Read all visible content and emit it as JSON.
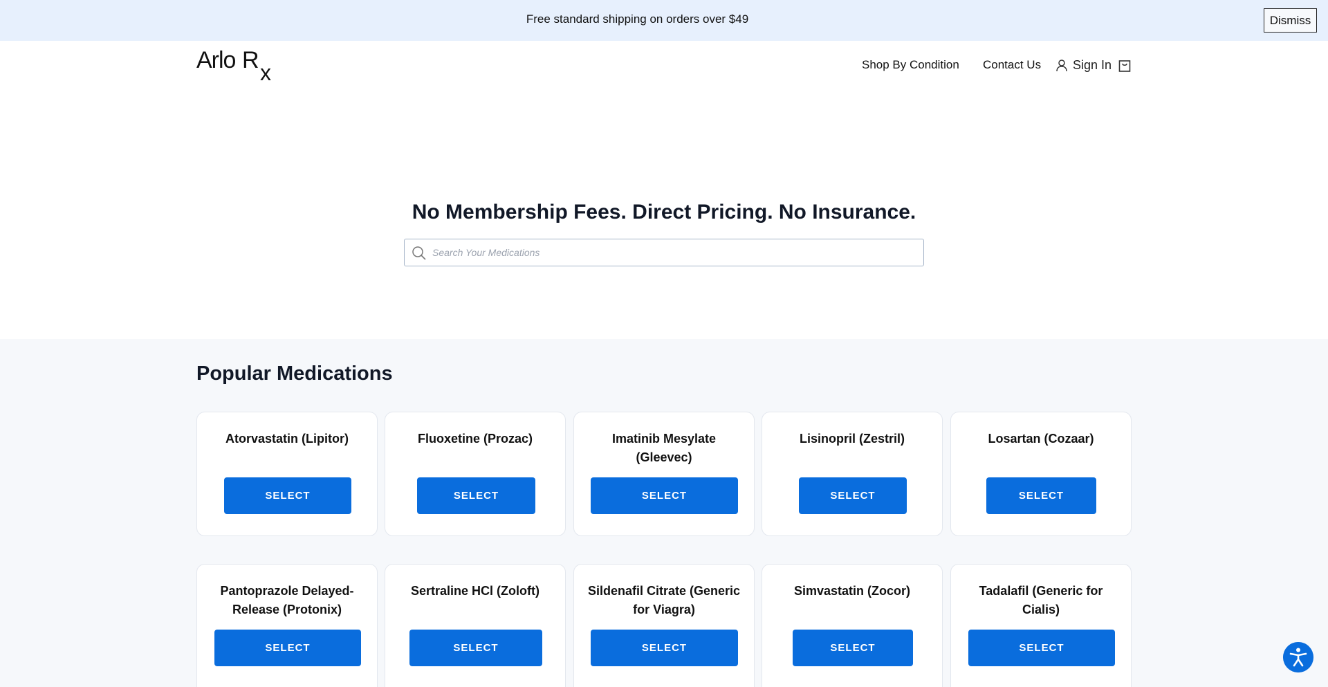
{
  "promo": {
    "text": "Free standard shipping on orders over $49",
    "dismiss_label": "Dismiss"
  },
  "header": {
    "logo": "ArloRx",
    "nav": {
      "shop_by_condition": "Shop By Condition",
      "contact_us": "Contact Us",
      "sign_in": "Sign In"
    },
    "icons": [
      "user-icon",
      "cart-icon"
    ]
  },
  "hero": {
    "title": "No Membership Fees. Direct Pricing. No Insurance.",
    "search_placeholder": "Search Your Medications"
  },
  "popular": {
    "title": "Popular Medications",
    "items": [
      {
        "name": "Atorvastatin (Lipitor)",
        "button": "SELECT"
      },
      {
        "name": "Fluoxetine (Prozac)",
        "button": "SELECT"
      },
      {
        "name": "Imatinib Mesylate (Gleevec)",
        "button": "SELECT"
      },
      {
        "name": "Lisinopril (Zestril)",
        "button": "SELECT"
      },
      {
        "name": "Losartan (Cozaar)",
        "button": "SELECT"
      },
      {
        "name": "Pantoprazole Delayed-Release (Protonix)",
        "button": "SELECT"
      },
      {
        "name": "Sertraline HCl (Zoloft)",
        "button": "SELECT"
      },
      {
        "name": "Sildenafil Citrate (Generic for Viagra)",
        "button": "SELECT"
      },
      {
        "name": "Simvastatin (Zocor)",
        "button": "SELECT"
      },
      {
        "name": "Tadalafil (Generic for Cialis)",
        "button": "SELECT"
      }
    ]
  },
  "colors": {
    "accent": "#0a6ddd",
    "promo_bg": "#e7f0fd",
    "section_bg": "#f6f8fb"
  }
}
